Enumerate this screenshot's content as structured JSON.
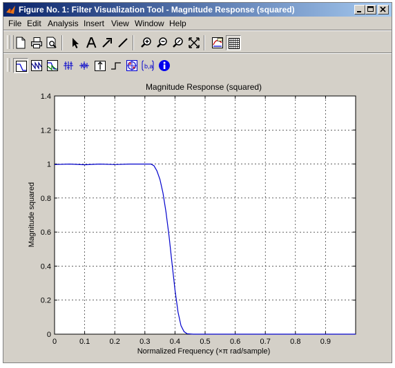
{
  "window": {
    "title": "Figure No. 1: Filter Visualization Tool - Magnitude Response (squared)",
    "title_icon": "matlab-logo-icon",
    "caption_buttons": [
      "minimize-icon",
      "maximize-icon",
      "close-icon"
    ]
  },
  "menu": {
    "items": [
      {
        "label": "File"
      },
      {
        "label": "Edit"
      },
      {
        "label": "Analysis"
      },
      {
        "label": "Insert"
      },
      {
        "label": "View"
      },
      {
        "label": "Window"
      },
      {
        "label": "Help"
      }
    ]
  },
  "toolbar1": {
    "buttons": [
      "new-figure-icon",
      "print-icon",
      "print-preview-icon",
      "select-arrow-icon",
      "insert-text-icon",
      "insert-arrow-icon",
      "insert-line-icon",
      "zoom-in-icon",
      "zoom-out-icon",
      "rotate-icon",
      "full-view-icon",
      "legend-icon",
      "grid-icon"
    ]
  },
  "toolbar2": {
    "buttons": [
      "magnitude-response-icon",
      "phase-response-icon",
      "magnitude-and-phase-icon",
      "group-delay-icon",
      "phase-delay-icon",
      "impulse-response-icon",
      "step-response-icon",
      "pole-zero-plot-icon",
      "filter-coefficients-icon",
      "filter-information-icon"
    ],
    "selected": "magnitude-response-icon"
  },
  "chart_data": {
    "type": "line",
    "title": "Magnitude Response (squared)",
    "xlabel": "Normalized Frequency (×π rad/sample)",
    "ylabel": "Magnitude squared",
    "xlim": [
      0,
      1
    ],
    "ylim": [
      0,
      1.4
    ],
    "xticks": [
      0,
      0.1,
      0.2,
      0.3,
      0.4,
      0.5,
      0.6,
      0.7,
      0.8,
      0.9
    ],
    "xtick_labels": [
      "0",
      "0.1",
      "0.2",
      "0.3",
      "0.4",
      "0.5",
      "0.6",
      "0.7",
      "0.8",
      "0.9"
    ],
    "yticks": [
      0,
      0.2,
      0.4,
      0.6,
      0.8,
      1,
      1.2,
      1.4
    ],
    "ytick_labels": [
      "0",
      "0.2",
      "0.4",
      "0.6",
      "0.8",
      "1",
      "1.2",
      "1.4"
    ],
    "grid": true,
    "line_color": "#0000cc",
    "series": [
      {
        "x": [
          0,
          0.05,
          0.1,
          0.15,
          0.2,
          0.25,
          0.3,
          0.32,
          0.33,
          0.34,
          0.35,
          0.36,
          0.37,
          0.38,
          0.39,
          0.4,
          0.41,
          0.42,
          0.43,
          0.44,
          0.46,
          0.5,
          0.6,
          0.7,
          0.8,
          0.9,
          1.0
        ],
        "y": [
          0.997,
          1.0,
          0.996,
          1.0,
          0.997,
          1.0,
          1.0,
          1.0,
          0.99,
          0.96,
          0.91,
          0.83,
          0.72,
          0.58,
          0.42,
          0.26,
          0.13,
          0.05,
          0.015,
          0.003,
          0.0,
          0.0,
          0.0,
          0.0,
          0.0,
          0.0,
          0.0
        ]
      }
    ]
  }
}
